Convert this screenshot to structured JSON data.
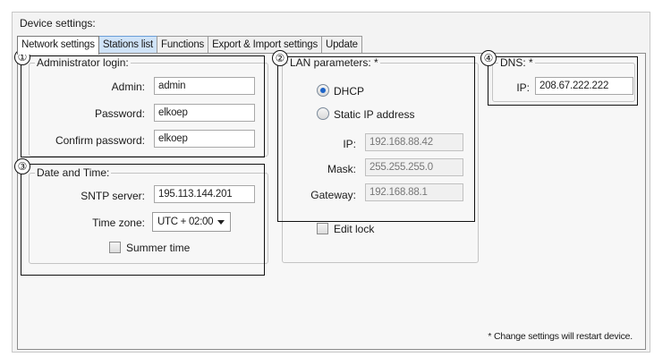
{
  "panel_title": "Device settings:",
  "tabs": [
    {
      "label": "Network settings"
    },
    {
      "label": "Stations list"
    },
    {
      "label": "Functions"
    },
    {
      "label": "Export & Import settings"
    },
    {
      "label": "Update"
    }
  ],
  "admin": {
    "number": "①",
    "title": "Administrator login:",
    "admin_label": "Admin:",
    "admin_value": "admin",
    "password_label": "Password:",
    "password_value": "elkoep",
    "confirm_label": "Confirm password:",
    "confirm_value": "elkoep"
  },
  "lan": {
    "number": "②",
    "title": "LAN parameters: *",
    "dhcp_label": "DHCP",
    "dhcp_checked": true,
    "static_label": "Static IP address",
    "ip_label": "IP:",
    "ip_value": "192.168.88.42",
    "mask_label": "Mask:",
    "mask_value": "255.255.255.0",
    "gateway_label": "Gateway:",
    "gateway_value": "192.168.88.1",
    "edit_lock_label": "Edit lock"
  },
  "datetime": {
    "number": "③",
    "title": "Date and Time:",
    "sntp_label": "SNTP server:",
    "sntp_value": "195.113.144.201",
    "timezone_label": "Time zone:",
    "timezone_value": "UTC + 02:00",
    "summer_label": "Summer time"
  },
  "dns": {
    "number": "④",
    "title": "DNS: *",
    "ip_label": "IP:",
    "ip_value": "208.67.222.222"
  },
  "footer_note": "* Change settings will restart device."
}
